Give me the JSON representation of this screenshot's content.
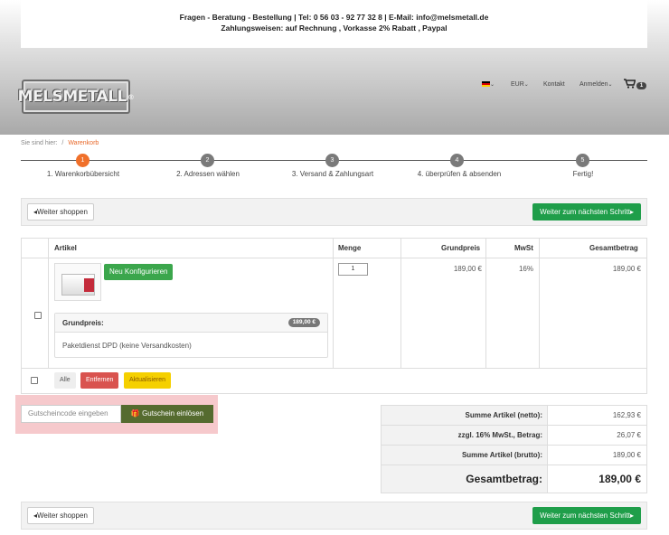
{
  "header": {
    "info_line1": "Fragen - Beratung - Bestellung | Tel: 0 56 03 - 92 77 32 8 | E-Mail: info@melsmetall.de",
    "info_line2": "Zahlungsweisen: auf Rechnung , Vorkasse 2% Rabatt , Paypal",
    "logo_text": "MELSMETALL",
    "logo_mark": "®",
    "currency": "EUR",
    "contact": "Kontakt",
    "login": "Anmelden",
    "cart_count": "1",
    "chevron": "⌄"
  },
  "breadcrumb": {
    "prefix": "Sie sind hier:",
    "separator": "/",
    "current": "Warenkorb"
  },
  "steps": [
    {
      "num": "1",
      "label": "1. Warenkorbübersicht"
    },
    {
      "num": "2",
      "label": "2. Adressen wählen"
    },
    {
      "num": "3",
      "label": "3. Versand & Zahlungsart"
    },
    {
      "num": "4",
      "label": "4. überprüfen & absenden"
    },
    {
      "num": "5",
      "label": "Fertig!"
    }
  ],
  "actions": {
    "continue_shopping": "Weiter shoppen",
    "next_step": "Weiter zum nächsten Schritt"
  },
  "cart": {
    "headers": {
      "article": "Artikel",
      "quantity": "Menge",
      "base_price": "Grundpreis",
      "vat": "MwSt",
      "total": "Gesamtbetrag"
    },
    "item": {
      "configure_button": "Neu Konfigurieren",
      "quantity": "1",
      "base_price": "189,00 €",
      "vat": "16%",
      "total": "189,00 €",
      "panel_title": "Grundpreis:",
      "panel_price": "189,00 €",
      "shipping": "Paketdienst DPD (keine Versandkosten)"
    },
    "footer": {
      "all": "Alle",
      "remove": "Entfernen",
      "update": "Aktualisieren"
    }
  },
  "coupon": {
    "placeholder": "Gutscheincode eingeben",
    "redeem": "Gutschein einlösen"
  },
  "totals": [
    {
      "label": "Summe Artikel (netto):",
      "value": "162,93 €"
    },
    {
      "label": "zzgl. 16% MwSt., Betrag:",
      "value": "26,07 €"
    },
    {
      "label": "Summe Artikel (brutto):",
      "value": "189,00 €"
    },
    {
      "label": "Gesamtbetrag:",
      "value": "189,00 €"
    }
  ],
  "colors": {
    "accent_orange": "#f0702a",
    "button_green": "#1f9e4a",
    "remove_red": "#d9534f",
    "update_yellow": "#f5d000",
    "coupon_highlight": "#f6c9cc"
  }
}
